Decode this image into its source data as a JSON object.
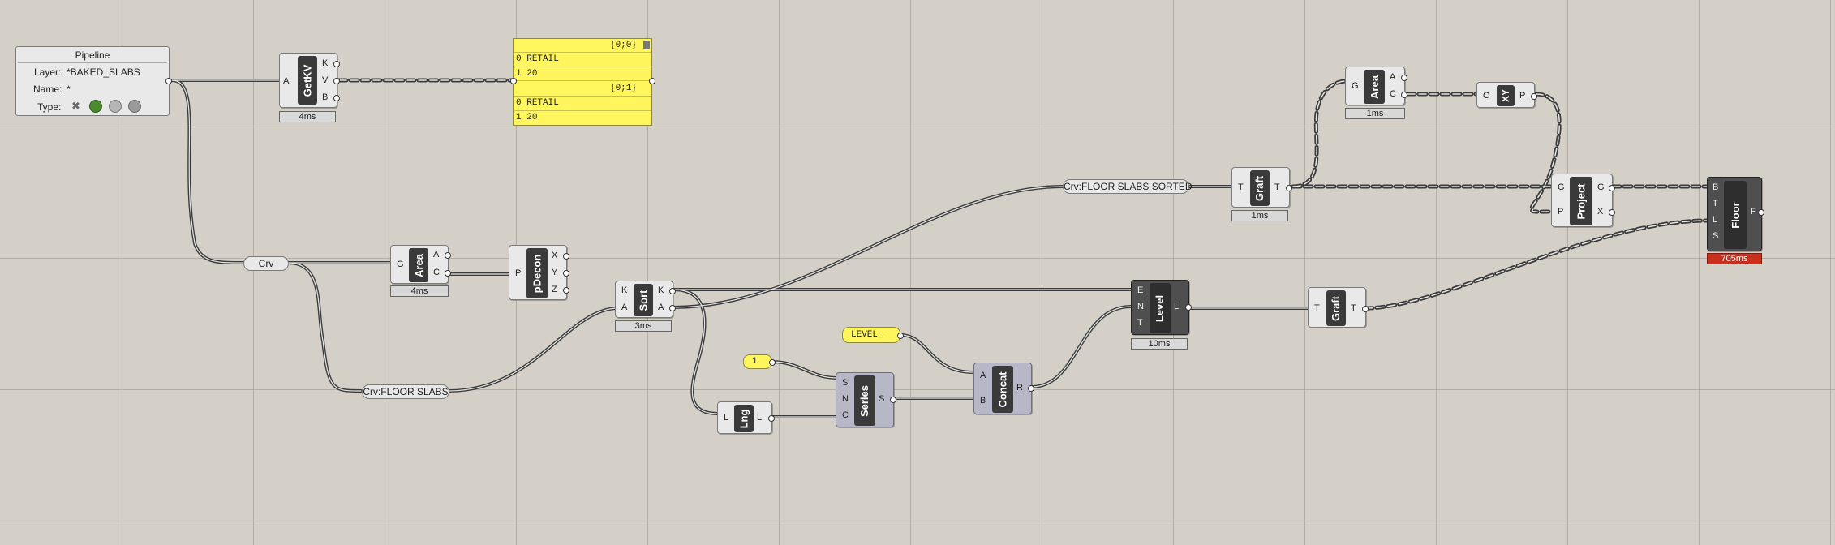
{
  "canvas": {
    "background": "#d4d0c8",
    "grid_color": "#a29e96"
  },
  "pipeline": {
    "title": "Pipeline",
    "layer_label": "Layer:",
    "layer_value": "*BAKED_SLABS",
    "name_label": "Name:",
    "name_value": "*",
    "type_label": "Type:"
  },
  "components": {
    "getkv": {
      "name": "GetKV",
      "inputs": [
        "A"
      ],
      "outputs": [
        "K",
        "V",
        "B"
      ],
      "timer": "4ms"
    },
    "area1": {
      "name": "Area",
      "inputs": [
        "G"
      ],
      "outputs": [
        "A",
        "C"
      ],
      "timer": "4ms"
    },
    "pdecon": {
      "name": "pDecon",
      "inputs": [
        "P"
      ],
      "outputs": [
        "X",
        "Y",
        "Z"
      ]
    },
    "sort": {
      "name": "Sort",
      "inputs": [
        "K",
        "A"
      ],
      "outputs": [
        "K",
        "A"
      ],
      "timer": "3ms"
    },
    "lng": {
      "name": "Lng",
      "inputs": [
        "L"
      ],
      "outputs": [
        "L"
      ]
    },
    "series": {
      "name": "Series",
      "inputs": [
        "S",
        "N",
        "C"
      ],
      "outputs": [
        "S"
      ]
    },
    "concat": {
      "name": "Concat",
      "inputs": [
        "A",
        "B"
      ],
      "outputs": [
        "R"
      ]
    },
    "level": {
      "name": "Level",
      "inputs": [
        "E",
        "N",
        "T"
      ],
      "outputs": [
        "L"
      ],
      "timer": "10ms"
    },
    "graft1": {
      "name": "Graft",
      "inputs": [
        "T"
      ],
      "outputs": [
        "T"
      ]
    },
    "graft2": {
      "name": "Graft",
      "inputs": [
        "T"
      ],
      "outputs": [
        "T"
      ],
      "timer": "1ms"
    },
    "area2": {
      "name": "Area",
      "inputs": [
        "G"
      ],
      "outputs": [
        "A",
        "C"
      ],
      "timer": "1ms"
    },
    "xy": {
      "name": "XY",
      "inputs": [
        "O"
      ],
      "outputs": [
        "P"
      ]
    },
    "project": {
      "name": "Project",
      "inputs": [
        "G",
        "P"
      ],
      "outputs": [
        "G",
        "X"
      ]
    },
    "floor": {
      "name": "Floor",
      "inputs": [
        "B",
        "T",
        "L",
        "S"
      ],
      "outputs": [
        "F"
      ],
      "timer": "705ms"
    }
  },
  "params": {
    "crv": "Crv",
    "crv_floor_slabs": "Crv:FLOOR SLABS",
    "crv_floor_slabs_sorted": "Crv:FLOOR SLABS SORTED",
    "level_text": "LEVEL_",
    "one": "1"
  },
  "panel": {
    "branches": [
      {
        "path": "{0;0}",
        "items": [
          {
            "index": "0",
            "value": "RETAIL"
          },
          {
            "index": "1",
            "value": "20"
          }
        ]
      },
      {
        "path": "{0;1}",
        "items": [
          {
            "index": "0",
            "value": "RETAIL"
          },
          {
            "index": "1",
            "value": "20"
          }
        ]
      }
    ]
  },
  "colors": {
    "panel": "#fef65c",
    "error_timer": "#c8301e",
    "wire": "#3b3b3b"
  }
}
